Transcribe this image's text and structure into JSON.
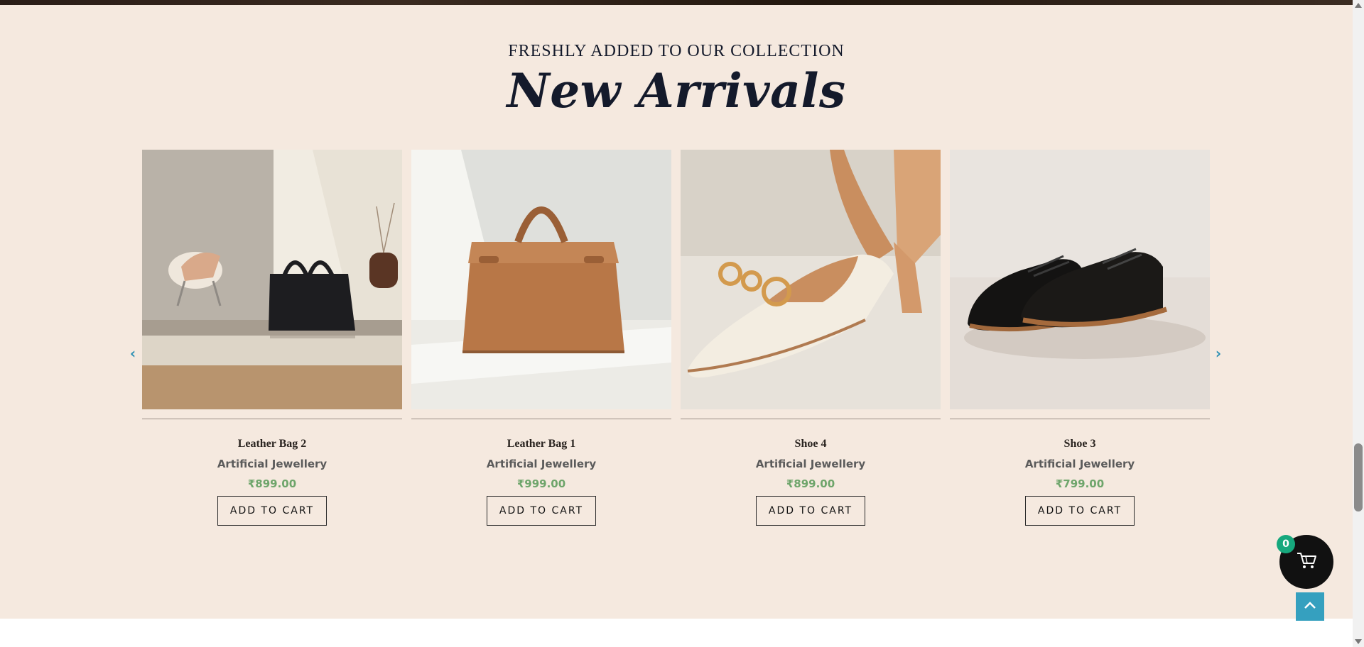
{
  "section": {
    "eyebrow": "FRESHLY ADDED TO OUR COLLECTION",
    "title": "New Arrivals"
  },
  "carousel": {
    "prev_icon": "chevron-left-icon",
    "next_icon": "chevron-right-icon",
    "products": [
      {
        "name": "Leather Bag 2",
        "category": "Artificial Jewellery",
        "price": "₹899.00",
        "button": "ADD TO CART",
        "image": "black-leather-bag-on-bench"
      },
      {
        "name": "Leather Bag 1",
        "category": "Artificial Jewellery",
        "price": "₹999.00",
        "button": "ADD TO CART",
        "image": "tan-leather-tote-bag"
      },
      {
        "name": "Shoe 4",
        "category": "Artificial Jewellery",
        "price": "₹899.00",
        "button": "ADD TO CART",
        "image": "cream-slingback-heel-with-chain"
      },
      {
        "name": "Shoe 3",
        "category": "Artificial Jewellery",
        "price": "₹799.00",
        "button": "ADD TO CART",
        "image": "black-oxford-shoes"
      }
    ]
  },
  "cart": {
    "count": "0",
    "icon": "cart-icon"
  },
  "back_to_top": {
    "icon": "chevron-up-icon"
  },
  "colors": {
    "section_bg": "#f5e9df",
    "heading": "#141a2b",
    "price": "#6ea56b",
    "accent": "#35a0bf",
    "badge": "#16a87d"
  }
}
